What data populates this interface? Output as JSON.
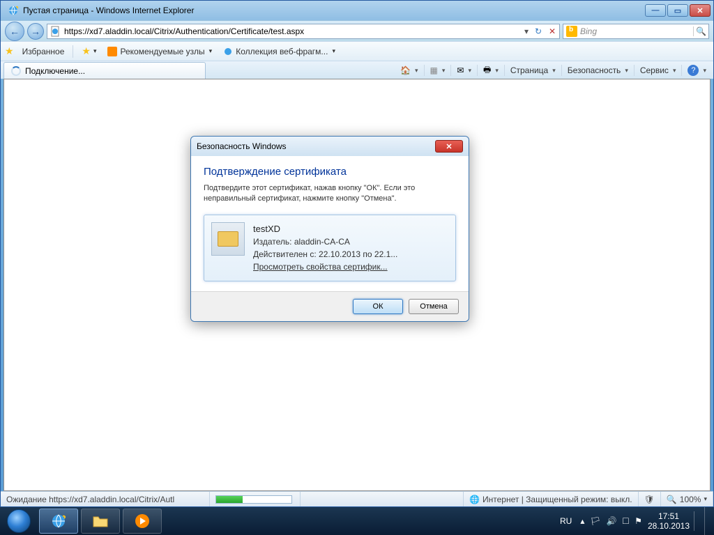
{
  "titlebar": {
    "title": "Пустая страница - Windows Internet Explorer",
    "min": "—",
    "max": "▭",
    "close": "✕"
  },
  "nav": {
    "url": "https://xd7.aladdin.local/Citrix/Authentication/Certificate/test.aspx",
    "search_placeholder": "Bing"
  },
  "favbar": {
    "favorites": "Избранное",
    "suggested": "Рекомендуемые узлы",
    "webslice": "Коллекция веб-фрагм..."
  },
  "tab": {
    "label": "Подключение..."
  },
  "cmdbar": {
    "page": "Страница",
    "safety": "Безопасность",
    "tools": "Сервис"
  },
  "status": {
    "waiting": "Ожидание https://xd7.aladdin.local/Citrix/Autl",
    "zone": "Интернет | Защищенный режим: выкл.",
    "zoom": "100%"
  },
  "dialog": {
    "title": "Безопасность Windows",
    "heading": "Подтверждение сертификата",
    "body": "Подтвердите этот сертификат, нажав кнопку \"ОК\". Если это неправильный сертификат, нажмите кнопку \"Отмена\".",
    "cert": {
      "name": "testXD",
      "issuer": "Издатель: aladdin-CA-CA",
      "valid": "Действителен с: 22.10.2013 по 22.1...",
      "view": "Просмотреть свойства сертифик..."
    },
    "ok": "ОК",
    "cancel": "Отмена"
  },
  "tray": {
    "lang": "RU",
    "time": "17:51",
    "date": "28.10.2013"
  }
}
